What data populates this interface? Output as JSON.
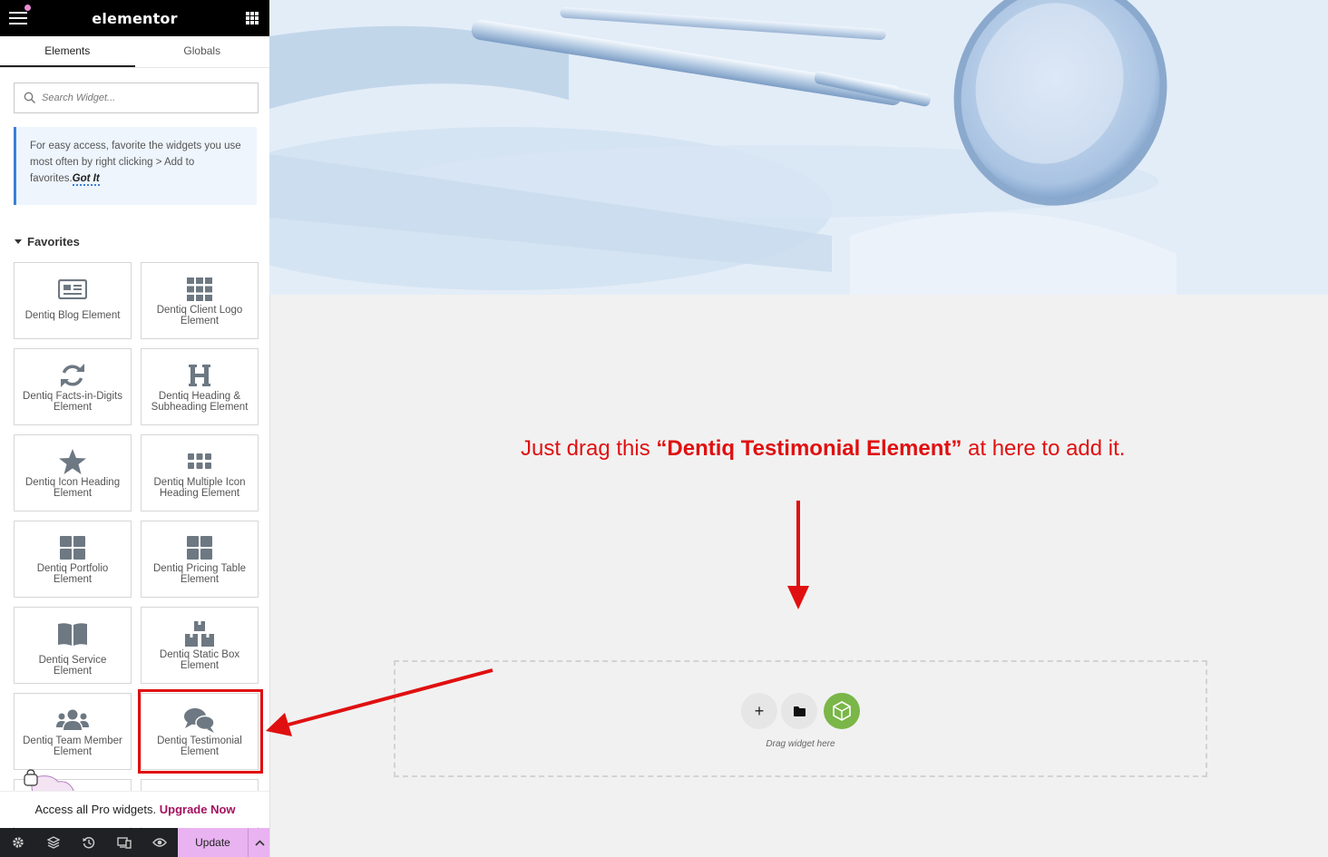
{
  "app": {
    "title": "elementor"
  },
  "tabs": [
    {
      "label": "Elements",
      "active": true
    },
    {
      "label": "Globals",
      "active": false
    }
  ],
  "search": {
    "placeholder": "Search Widget..."
  },
  "tip": {
    "text": "For easy access, favorite the widgets you use most often by right clicking > Add to favorites.",
    "link": "Got It"
  },
  "favorites": {
    "heading": "Favorites",
    "widgets": [
      {
        "label": "Dentiq Blog Element",
        "icon": "newspaper-icon"
      },
      {
        "label": "Dentiq Client Logo Element",
        "icon": "grid-icon"
      },
      {
        "label": "Dentiq Facts-in-Digits Element",
        "icon": "refresh-icon"
      },
      {
        "label": "Dentiq Heading & Subheading Element",
        "icon": "heading-icon"
      },
      {
        "label": "Dentiq Icon Heading Element",
        "icon": "star-icon"
      },
      {
        "label": "Dentiq Multiple Icon Heading Element",
        "icon": "dots-grid-icon"
      },
      {
        "label": "Dentiq Portfolio Element",
        "icon": "four-squares-icon"
      },
      {
        "label": "Dentiq Pricing Table Element",
        "icon": "four-squares-icon"
      },
      {
        "label": "Dentiq Service Element",
        "icon": "book-icon"
      },
      {
        "label": "Dentiq Static Box Element",
        "icon": "boxes-icon"
      },
      {
        "label": "Dentiq Team Member Element",
        "icon": "users-icon"
      },
      {
        "label": "Dentiq Testimonial Element",
        "icon": "comments-icon"
      }
    ]
  },
  "pro": {
    "text": "Access all Pro widgets.",
    "link": "Upgrade Now"
  },
  "footer": {
    "update_label": "Update"
  },
  "canvas": {
    "instruction_pre": "Just drag this ",
    "instruction_bold": "“Dentiq Testimonial Element”",
    "instruction_post": " at here to add it.",
    "dropzone_caption": "Drag widget here",
    "add_symbol": "+"
  },
  "colors": {
    "annotation": "#e01010",
    "accent_pink": "#e8b3f0",
    "kit_green": "#7ab648",
    "upgrade_link": "#a4115f"
  }
}
